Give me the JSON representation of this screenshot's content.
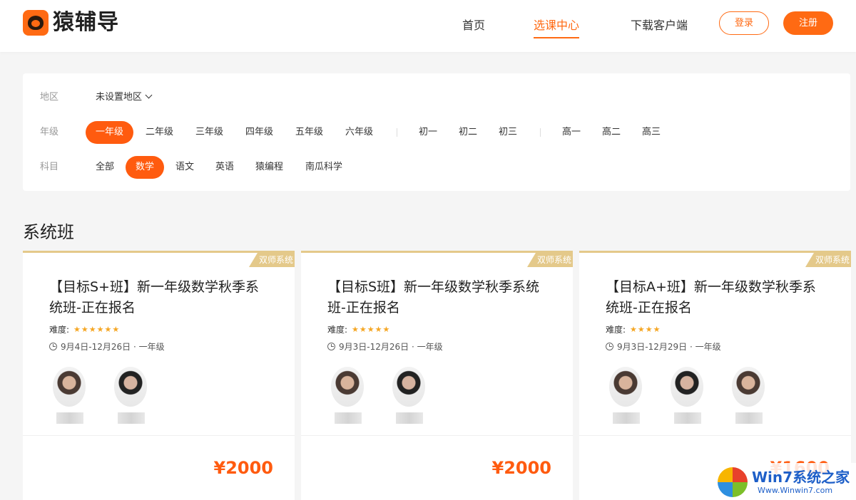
{
  "header": {
    "logo_text": "猿辅导",
    "nav": [
      {
        "label": "首页",
        "active": false
      },
      {
        "label": "选课中心",
        "active": true
      },
      {
        "label": "下载客户端",
        "active": false
      }
    ],
    "login_label": "登录",
    "register_label": "注册"
  },
  "filters": {
    "region": {
      "label": "地区",
      "value": "未设置地区"
    },
    "grade": {
      "label": "年级",
      "options": [
        "一年级",
        "二年级",
        "三年级",
        "四年级",
        "五年级",
        "六年级",
        "初一",
        "初二",
        "初三",
        "高一",
        "高二",
        "高三"
      ],
      "selected": "一年级"
    },
    "subject": {
      "label": "科目",
      "options": [
        "全部",
        "数学",
        "语文",
        "英语",
        "猿编程",
        "南瓜科学"
      ],
      "selected": "数学"
    }
  },
  "section_title": "系统班",
  "courses": [
    {
      "badge": "双师系统",
      "title": "【目标S+班】新一年级数学秋季系统班-正在报名",
      "difficulty_label": "难度:",
      "stars": 6,
      "dates": "9月4日-12月26日 · 一年级",
      "teacher_count": 2,
      "price": "¥2000"
    },
    {
      "badge": "双师系统",
      "title": "【目标S班】新一年级数学秋季系统班-正在报名",
      "difficulty_label": "难度:",
      "stars": 5,
      "dates": "9月3日-12月26日 · 一年级",
      "teacher_count": 2,
      "price": "¥2000"
    },
    {
      "badge": "双师系统",
      "title": "【目标A+班】新一年级数学秋季系统班-正在报名",
      "difficulty_label": "难度:",
      "stars": 4,
      "dates": "9月3日-12月29日 · 一年级",
      "teacher_count": 3,
      "price": "¥1600"
    }
  ],
  "watermark": {
    "main": "Win7系统之家",
    "sub": "Www.Winwin7.com"
  },
  "colors": {
    "accent": "#ff6a13",
    "gold": "#e4c98a",
    "star": "#f5a623"
  }
}
